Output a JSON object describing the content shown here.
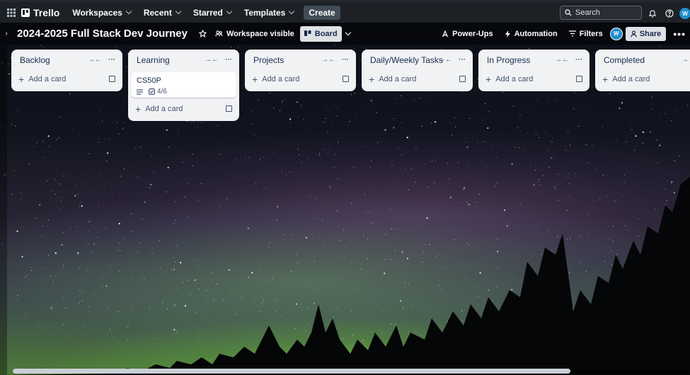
{
  "topnav": {
    "app_name": "Trello",
    "menu": [
      {
        "label": "Workspaces"
      },
      {
        "label": "Recent"
      },
      {
        "label": "Starred"
      },
      {
        "label": "Templates"
      }
    ],
    "create_label": "Create",
    "search_placeholder": "Search",
    "avatar_initials": "W"
  },
  "board": {
    "title": "2024-2025 Full Stack Dev Journey",
    "visibility_label": "Workspace visible",
    "view_label": "Board",
    "powerups_label": "Power-Ups",
    "automation_label": "Automation",
    "filters_label": "Filters",
    "avatar_initials": "W",
    "share_label": "Share"
  },
  "lists": [
    {
      "title": "Backlog",
      "add_card_label": "Add a card"
    },
    {
      "title": "Learning",
      "add_card_label": "Add a card",
      "cards": [
        {
          "title": "CS50P",
          "checklist": "4/6"
        }
      ]
    },
    {
      "title": "Projects",
      "add_card_label": "Add a card"
    },
    {
      "title": "Daily/Weekly Tasks",
      "add_card_label": "Add a card"
    },
    {
      "title": "In Progress",
      "add_card_label": "Add a card"
    },
    {
      "title": "Completed",
      "add_card_label": "Add a card"
    }
  ],
  "colors": {
    "nav_bg": "#1d2125",
    "list_bg": "#f1f2f4",
    "avatar": "#1e8ed0"
  }
}
